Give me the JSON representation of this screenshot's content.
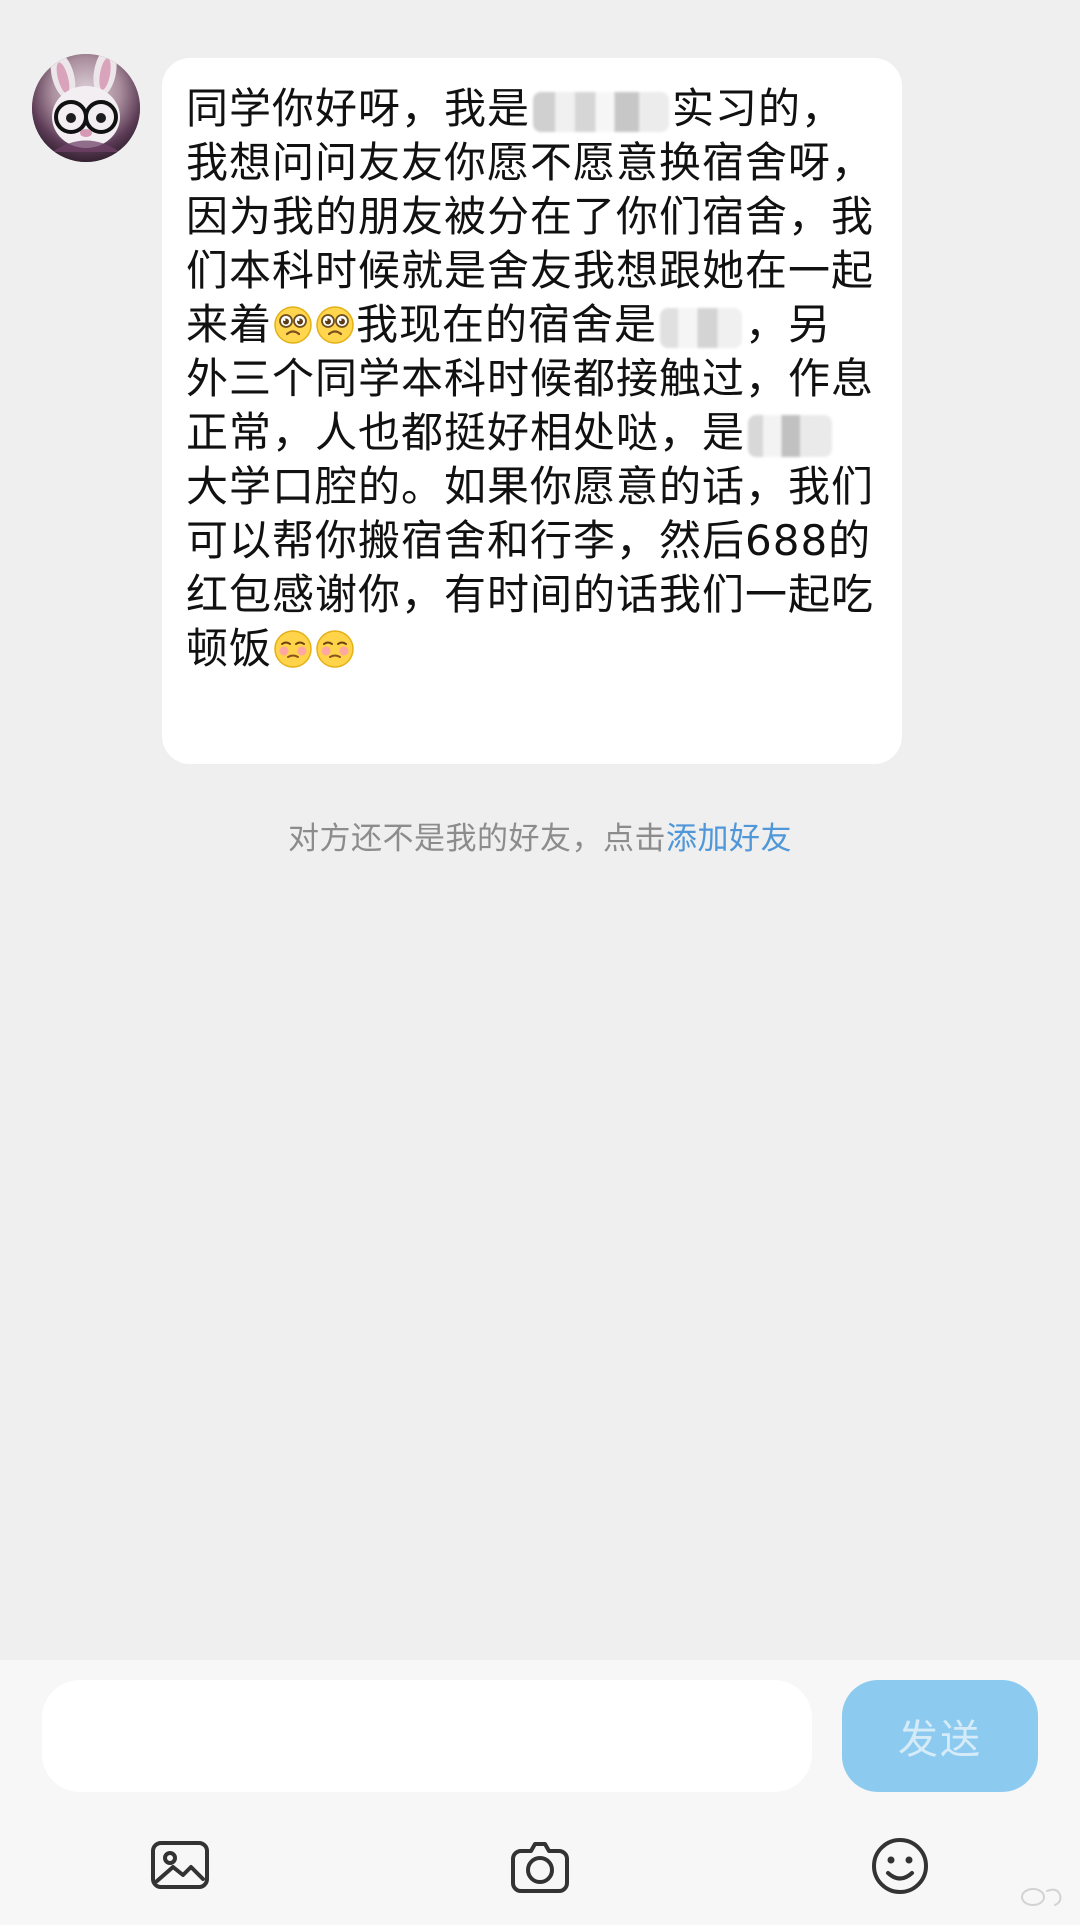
{
  "chat": {
    "message_segments": [
      "同学你好呀，我是",
      "实习的，我想问问友友你愿不愿意换宿舍呀，因为我的朋友被分在了你们宿舍，我们本科时候就是舍友我想跟她在一起来着",
      "我现在的宿舍是",
      "，另外三个同学本科时候都接触过，作息正常，人也都挺好相处哒，是",
      "大学口腔的。如果你愿意的话，我们可以帮你搬宿舍和行李，然后688的红包感谢你，有时间的话我们一起吃顿饭"
    ],
    "friend_notice": "对方还不是我的好友，点击",
    "add_friend_label": "添加好友"
  },
  "composer": {
    "input_value": "",
    "input_placeholder": "",
    "send_label": "发送"
  },
  "icons": {
    "avatar": "rabbit-avatar-icon",
    "pleading_emoji": "pleading-face-emoji-icon",
    "shy_emoji": "shy-face-emoji-icon",
    "gallery": "gallery-icon",
    "camera": "camera-icon",
    "emoji": "emoji-icon"
  },
  "colors": {
    "background": "#efefef",
    "bubble": "#ffffff",
    "text": "#111111",
    "secondary_text": "#8c8c8c",
    "link": "#4f97d8",
    "send_button": "#8ccaf0",
    "send_text": "#d5ecf8",
    "icon": "#333333"
  }
}
